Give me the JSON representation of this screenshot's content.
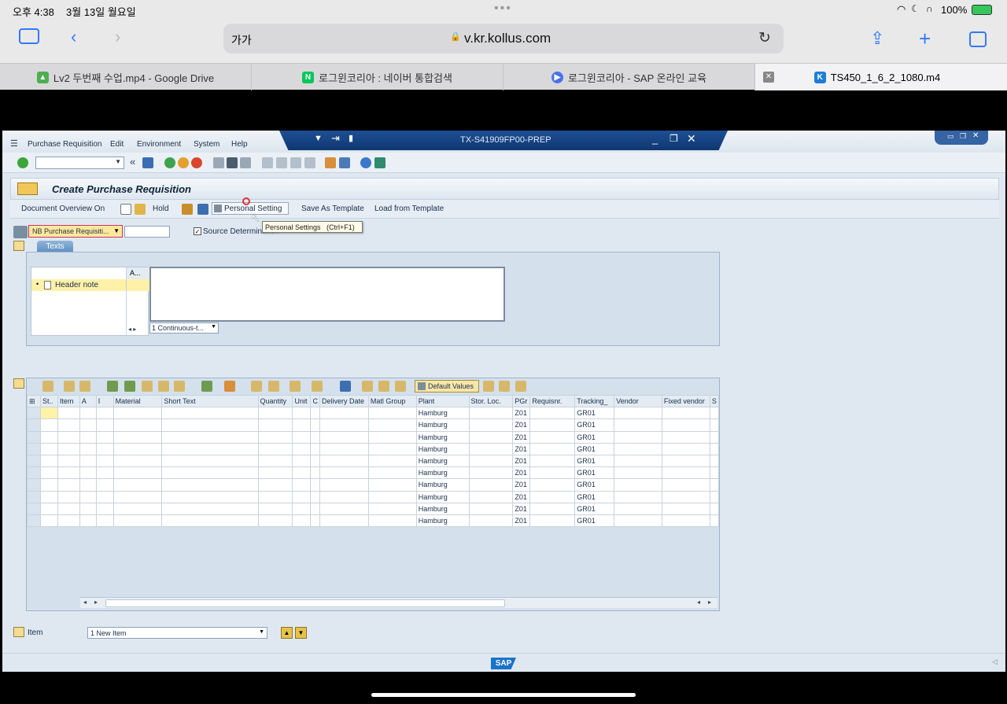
{
  "status_bar": {
    "time": "오후 4:38",
    "date": "3월 13일 월요일",
    "battery": "100%"
  },
  "browser": {
    "url_left": "가가",
    "url": "v.kr.kollus.com",
    "tabs": [
      {
        "label": "Lv2 두번째 수업.mp4 - Google Drive",
        "fav": "drive-icon",
        "color": "#4caf50"
      },
      {
        "label": "로그윈코리아 : 네이버 통합검색",
        "fav": "naver-icon",
        "color": "#03c75a"
      },
      {
        "label": "로그윈코리아 - SAP 온라인 교육",
        "fav": "play-icon",
        "color": "#4a72e8"
      },
      {
        "label": "TS450_1_6_2_1080.m4",
        "fav": "kollus-icon",
        "color": "#1c7ed6"
      }
    ]
  },
  "sap": {
    "menu": [
      "Purchase Requisition",
      "Edit",
      "Environment",
      "System",
      "Help"
    ],
    "window_title": "TX-S41909FP00-PREP",
    "page_title": "Create Purchase Requisition",
    "app_toolbar": {
      "doc_overview": "Document Overview On",
      "hold": "Hold",
      "personal_setting": "Personal Setting",
      "save_template": "Save As Template",
      "load_template": "Load from Template"
    },
    "tooltip": "Personal Settings   (Ctrl+F1)",
    "doc_type": "NB Purchase Requisiti...",
    "source_determination": "Source Determination",
    "header": {
      "tab": "Texts",
      "col_a": "A...",
      "tree_item": "Header note",
      "format_select": "1 Continuous-t..."
    },
    "items_toolbar": {
      "default_values": "Default Values"
    },
    "columns": [
      "St..",
      "Item",
      "A",
      "I",
      "Material",
      "Short Text",
      "Quantity",
      "Unit",
      "C",
      "Delivery Date",
      "Matl Group",
      "Plant",
      "Stor. Loc.",
      "PGr",
      "Requisnr.",
      "Tracking_",
      "Vendor",
      "Fixed vendor",
      "S"
    ],
    "rows": [
      {
        "plant": "Hamburg",
        "pgr": "Z01",
        "tracking": "GR01"
      },
      {
        "plant": "Hamburg",
        "pgr": "Z01",
        "tracking": "GR01"
      },
      {
        "plant": "Hamburg",
        "pgr": "Z01",
        "tracking": "GR01"
      },
      {
        "plant": "Hamburg",
        "pgr": "Z01",
        "tracking": "GR01"
      },
      {
        "plant": "Hamburg",
        "pgr": "Z01",
        "tracking": "GR01"
      },
      {
        "plant": "Hamburg",
        "pgr": "Z01",
        "tracking": "GR01"
      },
      {
        "plant": "Hamburg",
        "pgr": "Z01",
        "tracking": "GR01"
      },
      {
        "plant": "Hamburg",
        "pgr": "Z01",
        "tracking": "GR01"
      },
      {
        "plant": "Hamburg",
        "pgr": "Z01",
        "tracking": "GR01"
      },
      {
        "plant": "Hamburg",
        "pgr": "Z01",
        "tracking": "GR01"
      }
    ],
    "item_detail": {
      "label": "Item",
      "select": "1 New Item"
    },
    "footer_logo": "SAP"
  }
}
